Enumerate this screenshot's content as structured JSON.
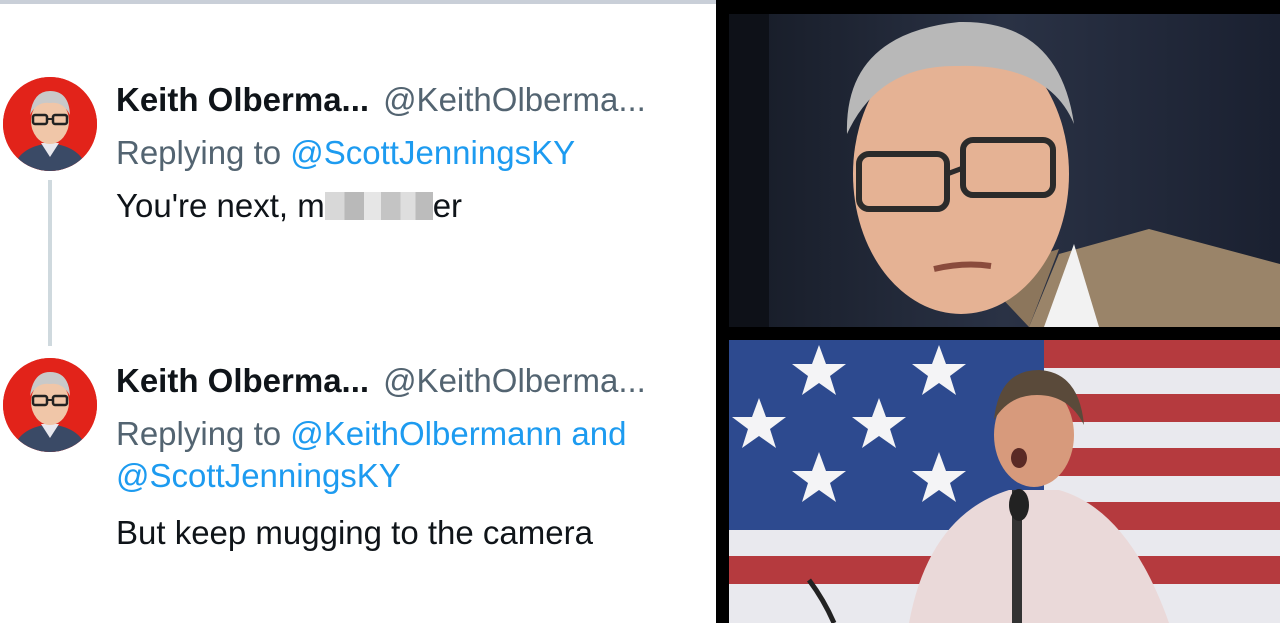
{
  "tweets": [
    {
      "display_name": "Keith Olberma...",
      "handle": "@KeithOlberma...",
      "replying_prefix": "Replying to ",
      "mentions": [
        "@ScottJenningsKY"
      ],
      "text_before": "You're next, m",
      "text_after": "er"
    },
    {
      "display_name": "Keith Olberma...",
      "handle": "@KeithOlberma...",
      "replying_prefix": "Replying to ",
      "mentions": [
        "@KeithOlbermann",
        "@ScottJenningsKY"
      ],
      "mention_joiner": " and",
      "text": "But keep mugging to the camera"
    }
  ],
  "colors": {
    "avatar_bg": "#e2231a",
    "mention": "#1d9bf0",
    "secondary_text": "#536471",
    "primary_text": "#0f1419"
  },
  "photos": [
    {
      "subject": "man-in-glasses-speaking-portrait"
    },
    {
      "subject": "man-speaking-at-microphone-in-front-of-us-flag"
    }
  ]
}
